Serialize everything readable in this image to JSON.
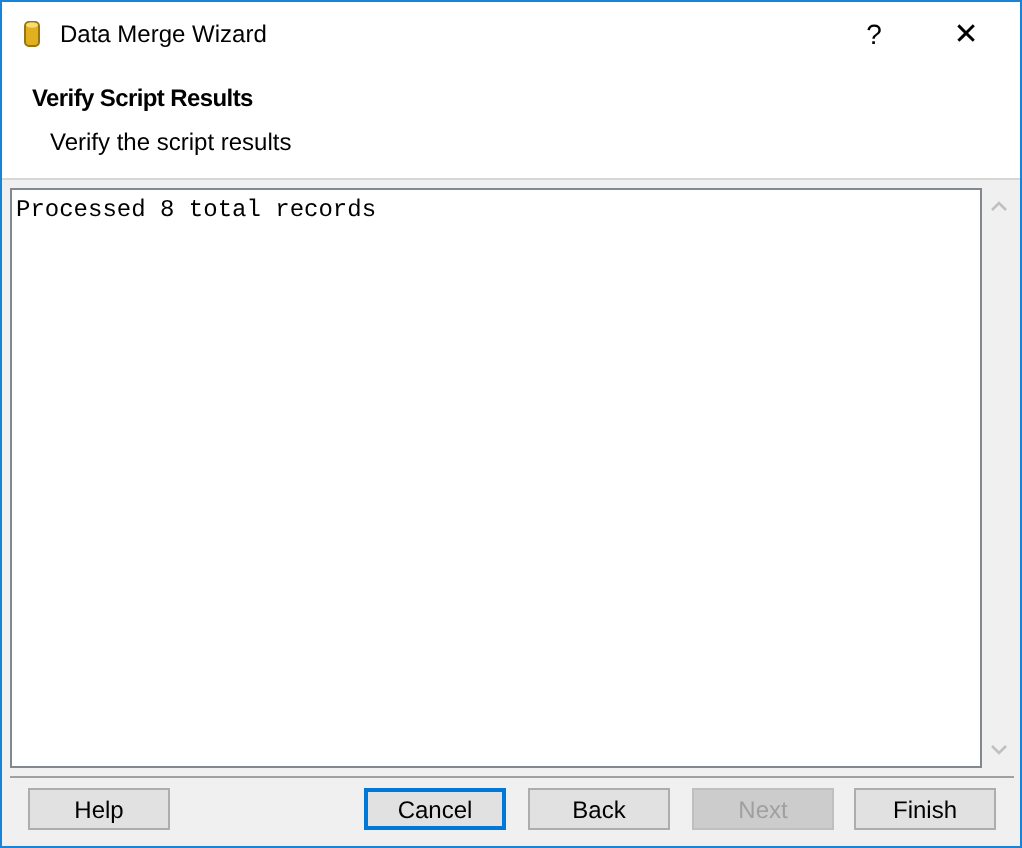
{
  "window": {
    "title": "Data Merge Wizard",
    "help_button": "?",
    "close_button": "✕"
  },
  "header": {
    "title": "Verify Script Results",
    "subtitle": "Verify the script results"
  },
  "output": {
    "text": "Processed 8 total records"
  },
  "left_buttons": [
    {
      "label": "Help",
      "disabled": false,
      "focused": false
    }
  ],
  "right_buttons": [
    {
      "label": "Cancel",
      "disabled": false,
      "focused": true
    },
    {
      "label": "Back",
      "disabled": false,
      "focused": false
    },
    {
      "label": "Next",
      "disabled": true,
      "focused": false
    },
    {
      "label": "Finish",
      "disabled": false,
      "focused": false
    }
  ]
}
